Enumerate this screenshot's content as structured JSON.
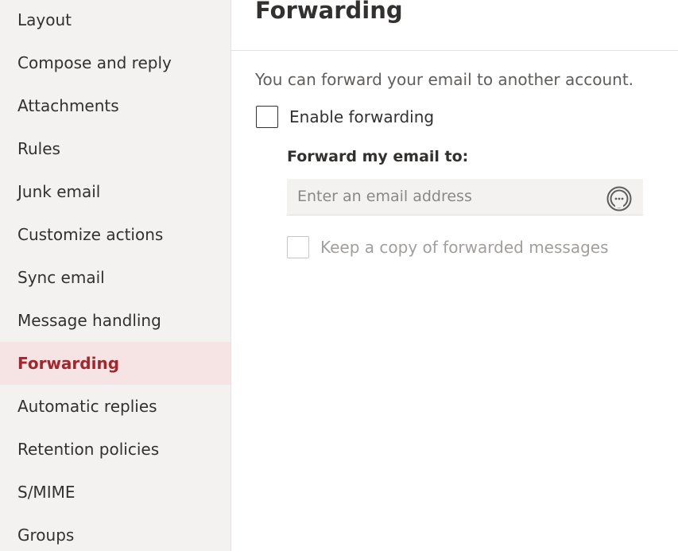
{
  "sidebar": {
    "items": [
      {
        "label": "Layout"
      },
      {
        "label": "Compose and reply"
      },
      {
        "label": "Attachments"
      },
      {
        "label": "Rules"
      },
      {
        "label": "Junk email"
      },
      {
        "label": "Customize actions"
      },
      {
        "label": "Sync email"
      },
      {
        "label": "Message handling"
      },
      {
        "label": "Forwarding",
        "selected": true
      },
      {
        "label": "Automatic replies"
      },
      {
        "label": "Retention policies"
      },
      {
        "label": "S/MIME"
      },
      {
        "label": "Groups"
      }
    ]
  },
  "main": {
    "title": "Forwarding",
    "description": "You can forward your email to another account.",
    "enable_forwarding": {
      "label": "Enable forwarding",
      "checked": false
    },
    "forward_to": {
      "label": "Forward my email to:",
      "placeholder": "Enter an email address",
      "value": "",
      "icon": "contact-picker-icon"
    },
    "keep_copy": {
      "label": "Keep a copy of forwarded messages",
      "checked": false,
      "disabled": true
    }
  },
  "colors": {
    "sidebar_bg": "#f3f2f1",
    "selected_bg": "#f6e4e4",
    "accent": "#a4262c",
    "text": "#323130",
    "muted_text": "#605e5c",
    "disabled_text": "#a19f9d"
  }
}
